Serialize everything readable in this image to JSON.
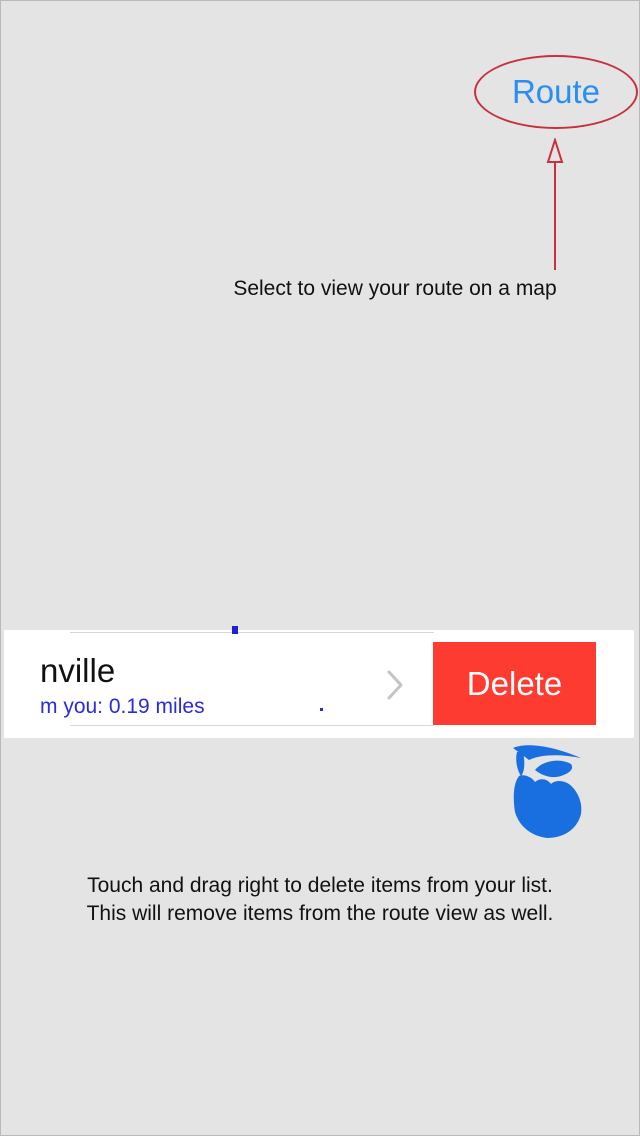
{
  "header": {
    "route_button_label": "Route"
  },
  "tips": {
    "route_hint": "Select to view your route on a map",
    "delete_hint_line1": "Touch and drag right to delete items from your list.",
    "delete_hint_line2": "This will remove items from the route view as well."
  },
  "list_item": {
    "name": "nville",
    "distance": "m you: 0.19 miles",
    "delete_label": "Delete"
  },
  "colors": {
    "background": "#e4e4e4",
    "accent_blue": "#2a8ff0",
    "annotation_red": "#c8303f",
    "delete_red": "#fe3b30",
    "distance_blue": "#2a2ae0",
    "hand_blue": "#1a6fe0"
  },
  "icons": {
    "arrow": "arrow-up-icon",
    "chevron": "chevron-right-icon",
    "hand": "swipe-hand-icon"
  }
}
